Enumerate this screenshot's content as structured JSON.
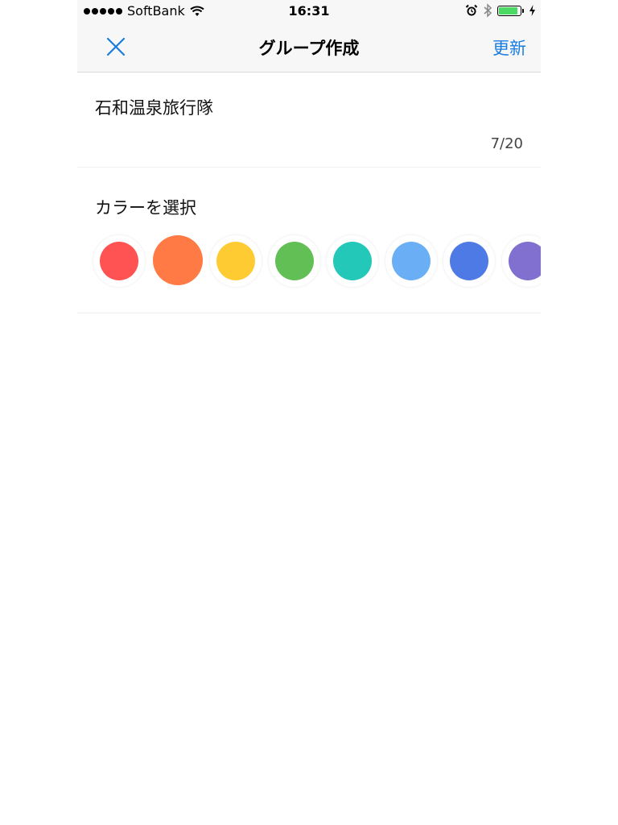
{
  "status_bar": {
    "carrier": "SoftBank",
    "time": "16:31",
    "battery_level": 0.9
  },
  "nav": {
    "title": "グループ作成",
    "update_label": "更新"
  },
  "group": {
    "name": "石和温泉旅行隊",
    "char_count": "7/20"
  },
  "colors": {
    "title": "カラーを選択",
    "options": [
      "#ff5252",
      "#ff7a45",
      "#ffcb33",
      "#62bf55",
      "#23c8b8",
      "#6aaff5",
      "#4e7ae5",
      "#8170cf"
    ],
    "selected": 1
  }
}
